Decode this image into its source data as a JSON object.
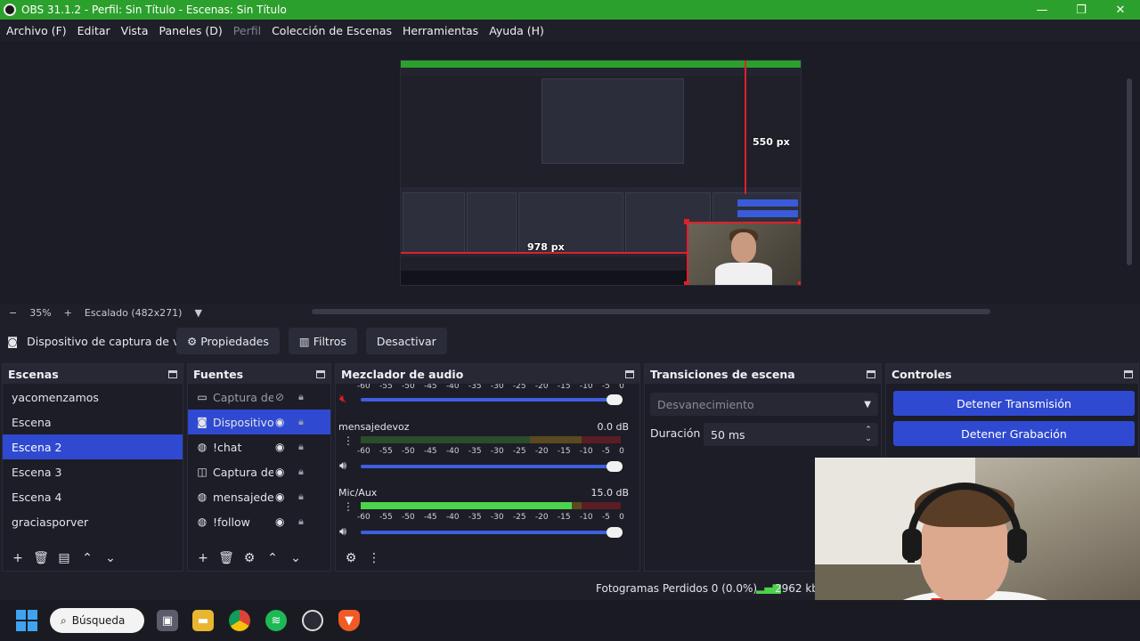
{
  "window": {
    "title": "OBS 31.1.2 - Perfil: Sin Título - Escenas: Sin Título",
    "minimize": "—",
    "maximize": "❐",
    "close": "✕"
  },
  "menu": [
    "Archivo (F)",
    "Editar",
    "Vista",
    "Paneles (D)",
    "Perfil",
    "Colección de Escenas",
    "Herramientas",
    "Ayuda (H)"
  ],
  "preview": {
    "dim_vertical": "550 px",
    "dim_horizontal": "978 px"
  },
  "zoom": {
    "minus": "−",
    "level": "35%",
    "plus": "+",
    "mode": "Escalado (482x271)",
    "dropdown": "▼"
  },
  "source_toolbar": {
    "source_name": "Dispositivo de captura de v",
    "properties": "Propiedades",
    "filters": "Filtros",
    "deactivate": "Desactivar"
  },
  "scenes": {
    "title": "Escenas",
    "items": [
      "yacomenzamos",
      "Escena",
      "Escena 2",
      "Escena 3",
      "Escena 4",
      "graciasporver"
    ],
    "selected_index": 2
  },
  "sources": {
    "title": "Fuentes",
    "items": [
      {
        "icon": "monitor-icon",
        "glyph": "▭",
        "name": "Captura de",
        "visible": false
      },
      {
        "icon": "camera-icon",
        "glyph": "◙",
        "name": "Dispositivo",
        "visible": true
      },
      {
        "icon": "browser-icon",
        "glyph": "◍",
        "name": "!chat",
        "visible": true
      },
      {
        "icon": "gamepad-icon",
        "glyph": "◫",
        "name": "Captura de",
        "visible": true
      },
      {
        "icon": "browser-icon",
        "glyph": "◍",
        "name": "mensajede",
        "visible": true
      },
      {
        "icon": "browser-icon",
        "glyph": "◍",
        "name": "!follow",
        "visible": true
      }
    ],
    "selected_index": 1
  },
  "mixer": {
    "title": "Mezclador de audio",
    "ticks": [
      "-60",
      "-55",
      "-50",
      "-45",
      "-40",
      "-35",
      "-30",
      "-25",
      "-20",
      "-15",
      "-10",
      "-5",
      "0"
    ],
    "channels": [
      {
        "name": "mensajedevoz",
        "db": "0.0 dB",
        "level": 0.0
      },
      {
        "name": "Mic/Aux",
        "db": "15.0 dB",
        "level": 0.81
      }
    ]
  },
  "transitions": {
    "title": "Transiciones de escena",
    "type": "Desvanecimiento",
    "duration_label": "Duración",
    "duration_value": "50 ms"
  },
  "controls": {
    "title": "Controles",
    "stop_stream": "Detener Transmisión",
    "stop_record": "Detener Grabación"
  },
  "status": {
    "dropped_frames": "Fotogramas Perdidos 0 (0.0%)",
    "bitrate": "2962 kbp"
  },
  "taskbar": {
    "search": "Búsqueda"
  },
  "colors": {
    "titlebar": "#2ca02c",
    "accent": "#2f4ad0",
    "record_red": "#e0202a"
  }
}
